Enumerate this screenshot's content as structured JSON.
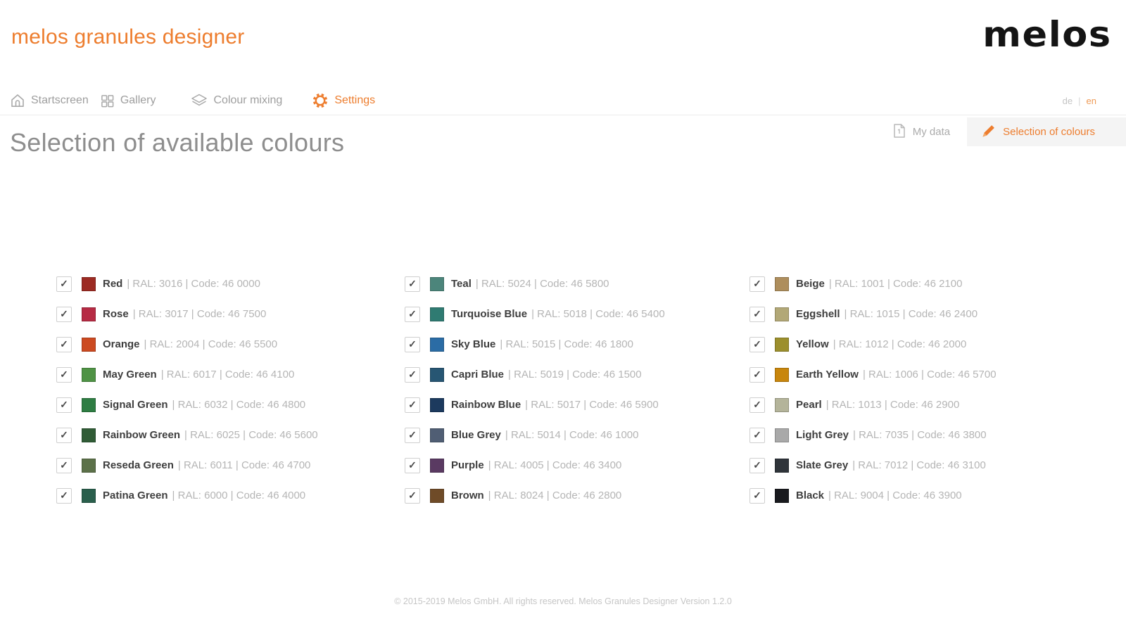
{
  "app": {
    "title": "melos granules designer",
    "logo": "melos"
  },
  "nav": {
    "items": [
      {
        "label": "Startscreen",
        "icon": "home-icon",
        "active": false
      },
      {
        "label": "Gallery",
        "icon": "gallery-icon",
        "active": false
      },
      {
        "label": "Colour mixing",
        "icon": "colour-mixing-icon",
        "active": false
      },
      {
        "label": "Settings",
        "icon": "settings-icon",
        "active": true
      }
    ],
    "language": {
      "options": [
        "de",
        "en"
      ],
      "separator": "|",
      "active": "en"
    }
  },
  "tabs": [
    {
      "label": "My data",
      "icon": "document-icon",
      "active": false
    },
    {
      "label": "Selection of colours",
      "icon": "pencil-icon",
      "active": true
    }
  ],
  "page": {
    "heading": "Selection of available colours"
  },
  "row_format": {
    "ral_prefix": "| RAL: ",
    "code_prefix": " | Code: "
  },
  "theme": {
    "accent": "#ED7D2E",
    "check_glyph": "✓",
    "tab_bg": "#F4F4F4"
  },
  "colour_columns": [
    [
      {
        "name": "Red",
        "ral": "3016",
        "code": "46 0000",
        "hex": "#9C2B23",
        "checked": true
      },
      {
        "name": "Rose",
        "ral": "3017",
        "code": "46 7500",
        "hex": "#B62B44",
        "checked": true
      },
      {
        "name": "Orange",
        "ral": "2004",
        "code": "46 5500",
        "hex": "#CC4A21",
        "checked": true
      },
      {
        "name": "May Green",
        "ral": "6017",
        "code": "46 4100",
        "hex": "#4F9345",
        "checked": true
      },
      {
        "name": "Signal Green",
        "ral": "6032",
        "code": "46 4800",
        "hex": "#2E7D43",
        "checked": true
      },
      {
        "name": "Rainbow Green",
        "ral": "6025",
        "code": "46 5600",
        "hex": "#305C36",
        "checked": true
      },
      {
        "name": "Reseda Green",
        "ral": "6011",
        "code": "46 4700",
        "hex": "#5C7149",
        "checked": true
      },
      {
        "name": "Patina Green",
        "ral": "6000",
        "code": "46 4000",
        "hex": "#2A5F4C",
        "checked": true
      }
    ],
    [
      {
        "name": "Teal",
        "ral": "5024",
        "code": "46 5800",
        "hex": "#4C857B",
        "checked": true
      },
      {
        "name": "Turquoise Blue",
        "ral": "5018",
        "code": "46 5400",
        "hex": "#2F7B72",
        "checked": true
      },
      {
        "name": "Sky Blue",
        "ral": "5015",
        "code": "46 1800",
        "hex": "#2B6CA5",
        "checked": true
      },
      {
        "name": "Capri Blue",
        "ral": "5019",
        "code": "46 1500",
        "hex": "#275673",
        "checked": true
      },
      {
        "name": "Rainbow Blue",
        "ral": "5017",
        "code": "46 5900",
        "hex": "#1C3A5E",
        "checked": true
      },
      {
        "name": "Blue Grey",
        "ral": "5014",
        "code": "46 1000",
        "hex": "#505E74",
        "checked": true
      },
      {
        "name": "Purple",
        "ral": "4005",
        "code": "46 3400",
        "hex": "#5A3A62",
        "checked": true
      },
      {
        "name": "Brown",
        "ral": "8024",
        "code": "46 2800",
        "hex": "#6F4B28",
        "checked": true
      }
    ],
    [
      {
        "name": "Beige",
        "ral": "1001",
        "code": "46 2100",
        "hex": "#AE8E5D",
        "checked": true
      },
      {
        "name": "Eggshell",
        "ral": "1015",
        "code": "46 2400",
        "hex": "#B2A877",
        "checked": true
      },
      {
        "name": "Yellow",
        "ral": "1012",
        "code": "46 2000",
        "hex": "#9C8F2D",
        "checked": true
      },
      {
        "name": "Earth Yellow",
        "ral": "1006",
        "code": "46 5700",
        "hex": "#C8860D",
        "checked": true
      },
      {
        "name": "Pearl",
        "ral": "1013",
        "code": "46 2900",
        "hex": "#B4B49A",
        "checked": true
      },
      {
        "name": "Light Grey",
        "ral": "7035",
        "code": "46 3800",
        "hex": "#A9A9A9",
        "checked": true
      },
      {
        "name": "Slate Grey",
        "ral": "7012",
        "code": "46 3100",
        "hex": "#2F343A",
        "checked": true
      },
      {
        "name": "Black",
        "ral": "9004",
        "code": "46 3900",
        "hex": "#191A1E",
        "checked": true
      }
    ]
  ],
  "footer": {
    "copyright": "© 2015-2019 Melos GmbH. All rights reserved. Melos Granules Designer Version 1.2.0"
  }
}
